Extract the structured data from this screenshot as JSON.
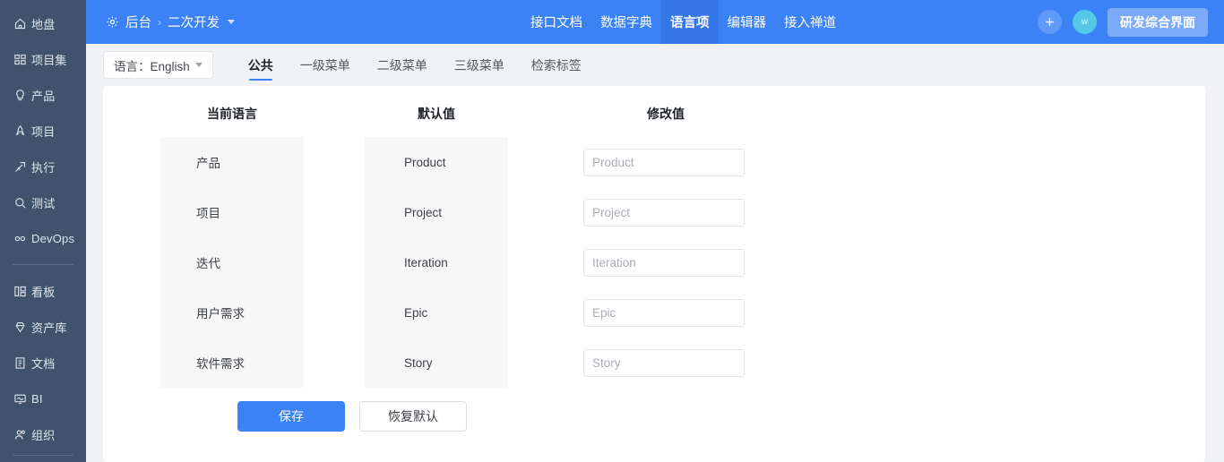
{
  "colors": {
    "brand_blue": "#3b82f6",
    "active_tab_blue": "#3577e8",
    "sidebar_bg": "#41536c",
    "page_bg": "#f1f2f5",
    "block_gray": "#f7f7f8",
    "avatar_cyan": "#55c8e8"
  },
  "sidebar": {
    "group1": [
      {
        "label": "地盘",
        "icon": "home-icon"
      },
      {
        "label": "项目集",
        "icon": "grid-icon"
      },
      {
        "label": "产品",
        "icon": "lightbulb-icon"
      },
      {
        "label": "项目",
        "icon": "rocket-icon"
      },
      {
        "label": "执行",
        "icon": "dart-icon"
      },
      {
        "label": "测试",
        "icon": "magnifier-icon"
      },
      {
        "label": "DevOps",
        "icon": "infinity-icon"
      }
    ],
    "group2": [
      {
        "label": "看板",
        "icon": "kanban-icon"
      },
      {
        "label": "资产库",
        "icon": "diamond-icon"
      },
      {
        "label": "文档",
        "icon": "document-icon"
      },
      {
        "label": "BI",
        "icon": "monitor-icon"
      },
      {
        "label": "组织",
        "icon": "people-icon"
      }
    ]
  },
  "header": {
    "breadcrumb": {
      "icon": "gear-icon",
      "root": "后台",
      "separator": "›",
      "current": "二次开发"
    },
    "nav": [
      {
        "label": "接口文档",
        "active": false
      },
      {
        "label": "数据字典",
        "active": false
      },
      {
        "label": "语言项",
        "active": true
      },
      {
        "label": "编辑器",
        "active": false
      },
      {
        "label": "接入禅道",
        "active": false
      }
    ],
    "add_button_icon": "plus-icon",
    "avatar_initial": "w",
    "workspace_button": "研发综合界面"
  },
  "toolbar": {
    "language_select": "语言：English",
    "tabs": [
      {
        "label": "公共",
        "active": true
      },
      {
        "label": "一级菜单",
        "active": false
      },
      {
        "label": "二级菜单",
        "active": false
      },
      {
        "label": "三级菜单",
        "active": false
      },
      {
        "label": "检索标签",
        "active": false
      }
    ]
  },
  "table": {
    "headers": {
      "current_language": "当前语言",
      "default_value": "默认值",
      "modified_value": "修改值"
    },
    "rows": [
      {
        "current": "产品",
        "default": "Product",
        "value": "",
        "placeholder": "Product"
      },
      {
        "current": "项目",
        "default": "Project",
        "value": "",
        "placeholder": "Project"
      },
      {
        "current": "迭代",
        "default": "Iteration",
        "value": "",
        "placeholder": "Iteration"
      },
      {
        "current": "用户需求",
        "default": "Epic",
        "value": "",
        "placeholder": "Epic"
      },
      {
        "current": "软件需求",
        "default": "Story",
        "value": "",
        "placeholder": "Story"
      }
    ]
  },
  "actions": {
    "save": "保存",
    "restore_default": "恢复默认"
  }
}
